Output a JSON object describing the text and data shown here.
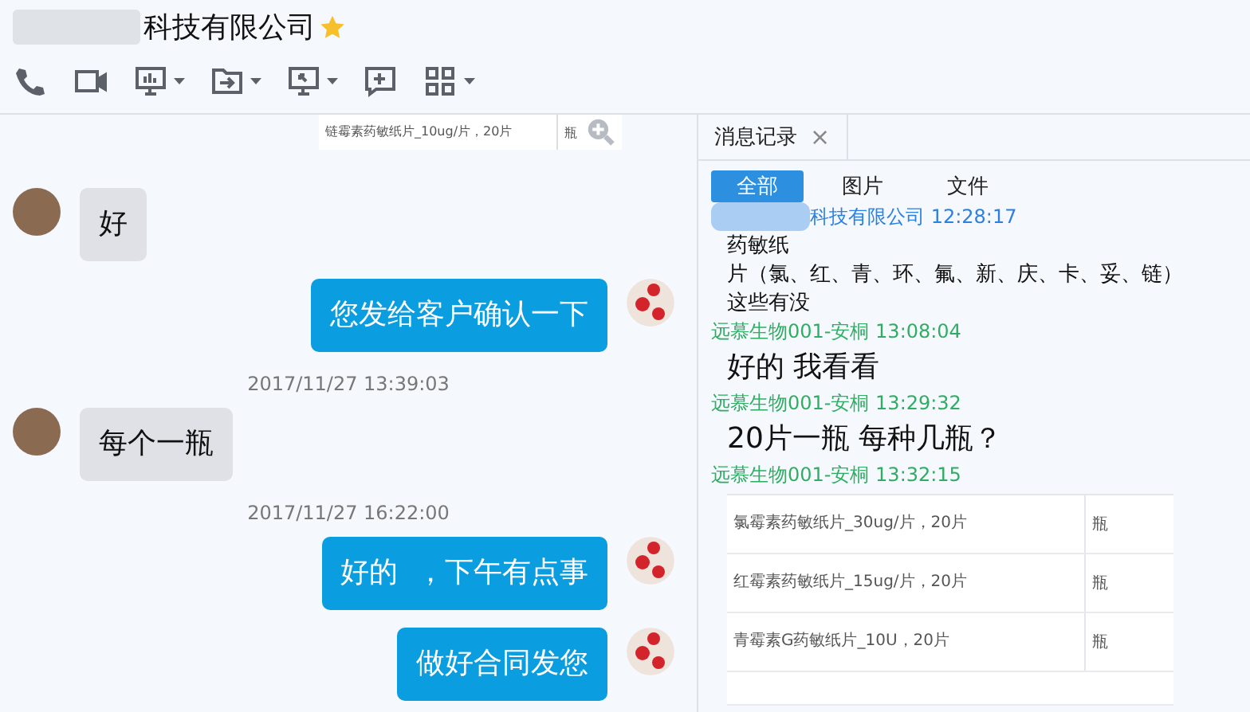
{
  "window": {
    "title": "科技有限公司"
  },
  "toolbar": {
    "tools": [
      {
        "kind": "phone",
        "dropdown": false
      },
      {
        "kind": "video",
        "dropdown": false
      },
      {
        "kind": "screen",
        "dropdown": true
      },
      {
        "kind": "file",
        "dropdown": true
      },
      {
        "kind": "remote",
        "dropdown": true
      },
      {
        "kind": "comment",
        "dropdown": false
      },
      {
        "kind": "apps",
        "dropdown": true
      }
    ]
  },
  "chat": {
    "top_attachment": {
      "name": "链霉素药敏纸片_10ug/片，20片",
      "unit": "瓶"
    },
    "messages": [
      {
        "kind": "incoming",
        "text": "好"
      },
      {
        "kind": "outgoing",
        "text": "您发给客户确认一下"
      },
      {
        "kind": "timestamp",
        "text": "2017/11/27 13:39:03"
      },
      {
        "kind": "incoming",
        "text": "每个一瓶"
      },
      {
        "kind": "timestamp",
        "text": "2017/11/27 16:22:00"
      },
      {
        "kind": "outgoing",
        "text": "好的  ，下午有点事"
      },
      {
        "kind": "outgoing",
        "text": "做好合同发您"
      }
    ]
  },
  "history": {
    "tab_label": "消息记录",
    "close": "×",
    "filters": [
      {
        "label": "全部",
        "selected": true
      },
      {
        "label": "图片",
        "selected": false
      },
      {
        "label": "文件",
        "selected": false
      }
    ],
    "entries": [
      {
        "kind": "small_text",
        "sender": "科技有限公司 12:28:17",
        "self": false,
        "lines": [
          "药敏纸",
          "片（氯、红、青、环、氟、新、庆、卡、妥、链）",
          "这些有没"
        ]
      },
      {
        "kind": "large_text",
        "sender": "远慕生物001-安桐 13:08:04",
        "self": true,
        "lines": [
          "好的  我看看"
        ]
      },
      {
        "kind": "large_text",
        "sender": "远慕生物001-安桐 13:29:32",
        "self": true,
        "lines": [
          "20片一瓶  每种几瓶？"
        ]
      },
      {
        "kind": "table",
        "sender": "远慕生物001-安桐 13:32:15",
        "self": true,
        "rows": [
          {
            "name": "氯霉素药敏纸片_30ug/片，20片",
            "unit": "瓶"
          },
          {
            "name": "红霉素药敏纸片_15ug/片，20片",
            "unit": "瓶"
          },
          {
            "name": "青霉素G药敏纸片_10U，20片",
            "unit": "瓶"
          }
        ]
      }
    ]
  }
}
